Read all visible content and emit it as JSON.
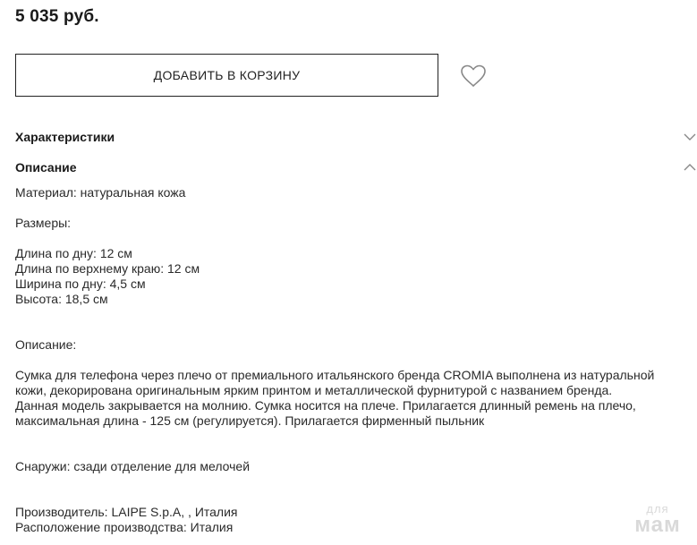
{
  "product": {
    "price": "5 035 руб."
  },
  "actions": {
    "add_to_cart_label": "ДОБАВИТЬ В КОРЗИНУ",
    "wishlist_icon": "heart-outline"
  },
  "sections": {
    "characteristics": {
      "title": "Характеристики",
      "expanded": false,
      "icon": "chevron-down"
    },
    "description": {
      "title": "Описание",
      "expanded": true,
      "icon": "chevron-up",
      "lines": [
        "Материал: натуральная кожа",
        "",
        "Размеры:",
        "",
        "Длина по дну: 12 см",
        "Длина по верхнему краю: 12 см",
        "Ширина по дну: 4,5 см",
        "Высота: 18,5 см",
        "",
        "",
        "Описание:",
        "",
        "Сумка для телефона через плечо от премиального итальянского бренда CROMIA выполнена из натуральной",
        "кожи, декорирована оригинальным ярким принтом и металлической фурнитурой с названием бренда.",
        "Данная модель закрывается на молнию. Сумка носится на плече. Прилагается длинный ремень на плечо,",
        "максимальная длина - 125 см (регулируется). Прилагается фирменный пыльник",
        "",
        "",
        "Снаружи: сзади отделение для мелочей",
        "",
        "",
        "Производитель: LAIPE S.p.A, , Италия",
        "Расположение производства: Италия"
      ]
    }
  },
  "watermark": {
    "line1": "для",
    "line2": "мам"
  }
}
